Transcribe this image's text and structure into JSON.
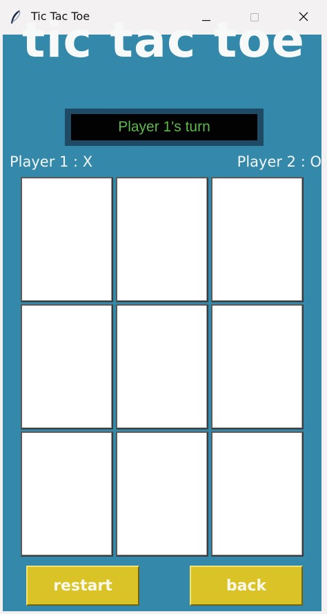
{
  "window": {
    "title": "Tic Tac Toe"
  },
  "game": {
    "heading": "tic tac toe",
    "status": "Player 1's turn",
    "player1_label": "Player 1 : X",
    "player2_label": "Player 2 : O",
    "board": [
      "",
      "",
      "",
      "",
      "",
      "",
      "",
      "",
      ""
    ]
  },
  "buttons": {
    "restart": "restart",
    "back": "back"
  },
  "colors": {
    "background": "#3489aa",
    "status_text": "#5cb84a",
    "button": "#d9c326"
  }
}
